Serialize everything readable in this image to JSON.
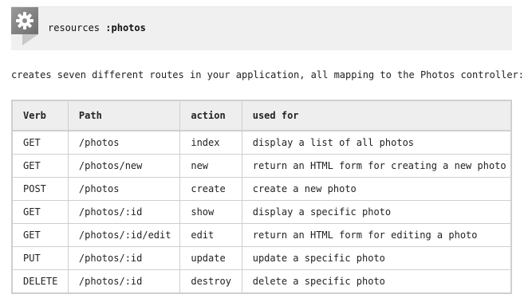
{
  "code": {
    "keyword": "resources",
    "symbol": ":photos"
  },
  "description": "creates seven different routes in your application, all mapping to the Photos controller:",
  "table": {
    "headers": {
      "verb": "Verb",
      "path": "Path",
      "action": "action",
      "used_for": "used for"
    },
    "rows": [
      {
        "verb": "GET",
        "path": "/photos",
        "action": "index",
        "used_for": "display a list of all photos"
      },
      {
        "verb": "GET",
        "path": "/photos/new",
        "action": "new",
        "used_for": "return an HTML form for creating a new photo"
      },
      {
        "verb": "POST",
        "path": "/photos",
        "action": "create",
        "used_for": "create a new photo"
      },
      {
        "verb": "GET",
        "path": "/photos/:id",
        "action": "show",
        "used_for": "display a specific photo"
      },
      {
        "verb": "GET",
        "path": "/photos/:id/edit",
        "action": "edit",
        "used_for": "return an HTML form for editing a photo"
      },
      {
        "verb": "PUT",
        "path": "/photos/:id",
        "action": "update",
        "used_for": "update a specific photo"
      },
      {
        "verb": "DELETE",
        "path": "/photos/:id",
        "action": "destroy",
        "used_for": "delete a specific photo"
      }
    ]
  },
  "icons": {
    "code_badge": "gear-icon"
  },
  "colors": {
    "code_background": "#f0f0f0",
    "table_header_background": "#eeeeee",
    "border": "#cfcfcf",
    "badge": "#7a7a7a"
  }
}
